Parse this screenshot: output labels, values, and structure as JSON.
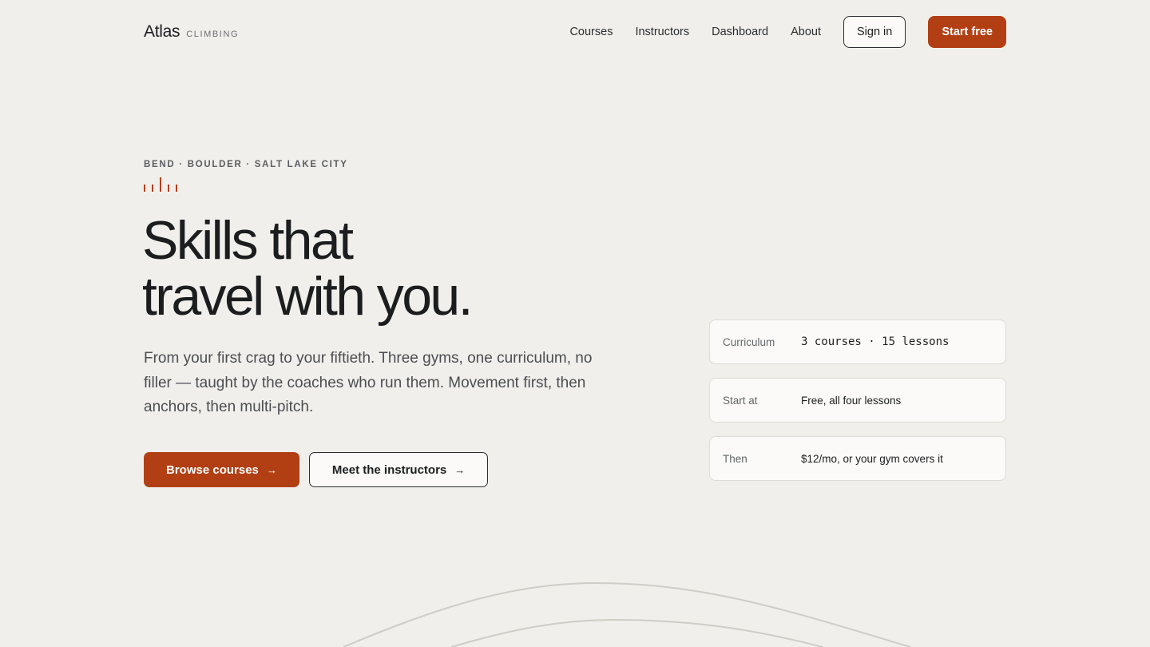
{
  "brand": {
    "name": "Atlas",
    "sub": "CLIMBING"
  },
  "nav": {
    "links": [
      "Courses",
      "Instructors",
      "Dashboard",
      "About"
    ],
    "sign_in": "Sign in",
    "start_free": "Start free"
  },
  "hero": {
    "eyebrow": "BEND · BOULDER · SALT LAKE CITY",
    "headline_line1": "Skills that",
    "headline_line2": "travel with you.",
    "lede": "From your first crag to your fiftieth. Three gyms, one curriculum, no filler — taught by the coaches who run them. Movement first, then anchors, then multi-pitch.",
    "cta_primary": "Browse courses",
    "cta_secondary": "Meet the instructors",
    "arrow": "→"
  },
  "cards": [
    {
      "label": "Curriculum",
      "value": "3 courses · 15 lessons"
    },
    {
      "label": "Start at",
      "value": "Free, all four lessons"
    },
    {
      "label": "Then",
      "value": "$12/mo, or your gym covers it"
    }
  ],
  "colors": {
    "background": "#f1efeb",
    "accent": "#b23f14",
    "text": "#1c1e20",
    "card_border": "#dedbd6"
  },
  "icons": {
    "arrow": "arrow-right-icon",
    "ticks": "tick-marks-icon"
  }
}
